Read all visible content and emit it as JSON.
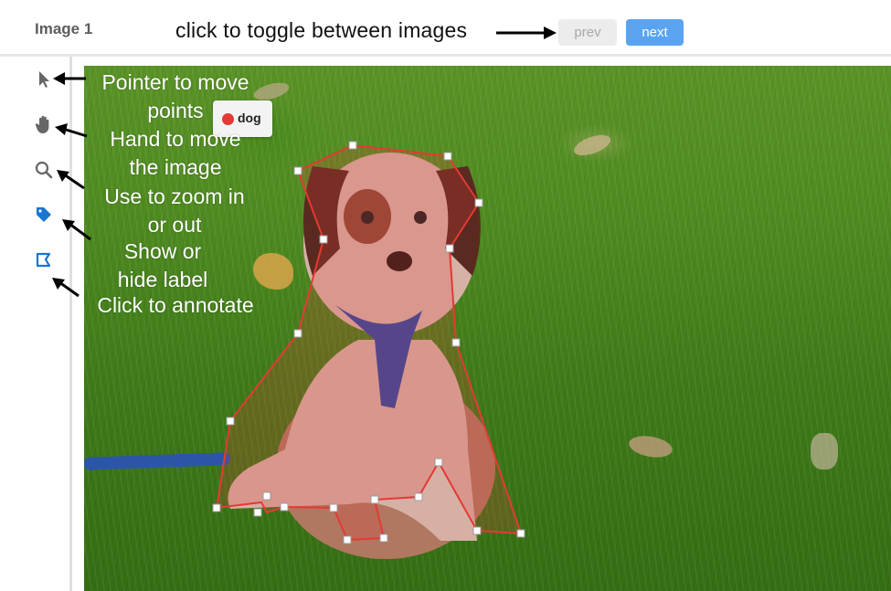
{
  "header": {
    "title": "Image 1",
    "hint": "click to toggle between images",
    "prev_label": "prev",
    "next_label": "next"
  },
  "tools": [
    {
      "name": "pointer",
      "icon": "cursor-icon",
      "description": "Pointer to move points"
    },
    {
      "name": "hand",
      "icon": "hand-icon",
      "description": "Hand to move the image"
    },
    {
      "name": "zoom",
      "icon": "magnifier-icon",
      "description": "Use to zoom in or out"
    },
    {
      "name": "label",
      "icon": "tag-icon",
      "description": "Show or hide label"
    },
    {
      "name": "annotate",
      "icon": "polygon-icon",
      "description": "Click to annotate"
    }
  ],
  "annotations": {
    "pointer": "Pointer to move points",
    "hand": "Hand to move the image",
    "zoom": "Use to zoom in or out",
    "label": "Show or hide label",
    "annotate": "Click to annotate"
  },
  "region": {
    "label": "dog",
    "color": "#e53935"
  },
  "colors": {
    "accent": "#5aa3f1",
    "active_tool": "#1976d2",
    "polygon": "#e53935"
  }
}
